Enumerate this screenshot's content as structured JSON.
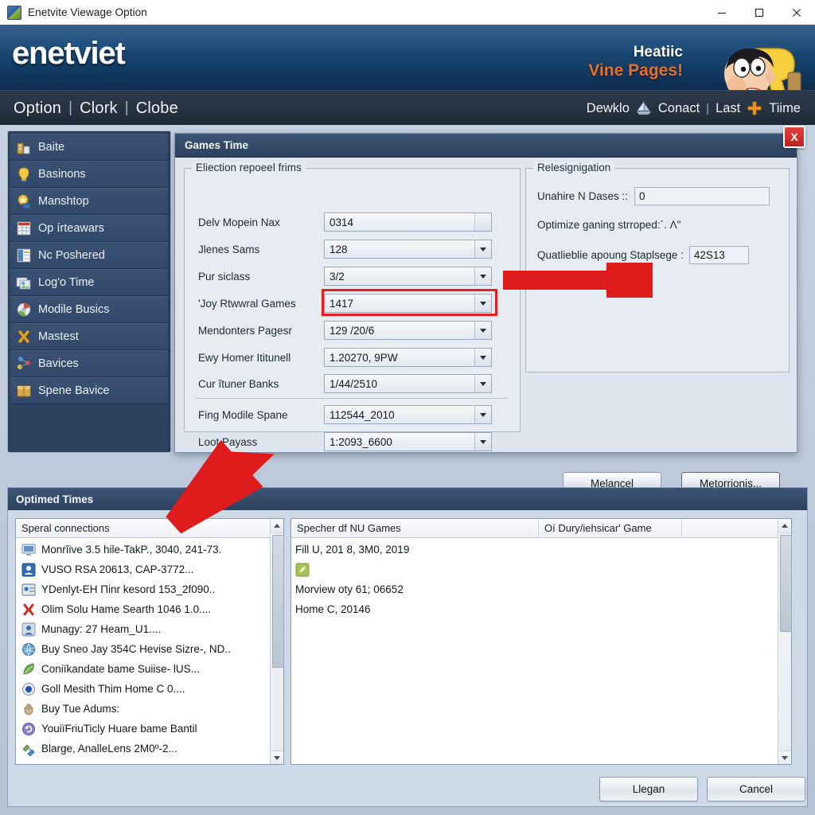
{
  "window": {
    "title": "Enetvite Viewage Option",
    "icon": "app-icon",
    "minimize": "minimize-icon",
    "maximize": "maximize-icon",
    "close": "close-icon"
  },
  "banner": {
    "brand": "enetviet",
    "tagline_line1": "Heatiic",
    "tagline_line2": "Vine Pages!",
    "mascot": "mascot-character",
    "colors": {
      "brand_bg_top": "#1d4f7e",
      "brand_bg_bottom": "#0d2c4d",
      "tagline_accent": "#e8702a"
    }
  },
  "nav": {
    "left": [
      "Option",
      "Clork",
      "Clobe"
    ],
    "separator": "|",
    "right": {
      "item1": "Dewklo",
      "boat_icon": "boat-icon",
      "item2": "Conact",
      "separator": "|",
      "item3": "Last",
      "plus_icon": "plus-icon",
      "item4": "Tiime"
    }
  },
  "sidebar": {
    "items": [
      {
        "label": "Baite",
        "icon": "buildings-icon"
      },
      {
        "label": "Basinons",
        "icon": "lightbulb-icon"
      },
      {
        "label": "Manshtop",
        "icon": "gold-badge-icon"
      },
      {
        "label": "Op írteawars",
        "icon": "spreadsheet-icon"
      },
      {
        "label": "Nc Poshered",
        "icon": "document-icon"
      },
      {
        "label": "Log'o Time",
        "icon": "photos-icon"
      },
      {
        "label": "Modile Busics",
        "icon": "disc-icon"
      },
      {
        "label": "Mastest",
        "icon": "x-cross-icon"
      },
      {
        "label": "Bavices",
        "icon": "network-icon"
      },
      {
        "label": "Spene Bavice",
        "icon": "package-icon"
      }
    ]
  },
  "dialog": {
    "title": "Games Time",
    "close_label": "X",
    "left_group": {
      "legend": "Eliection repoeel frims",
      "fields": [
        {
          "label": "Delv Mopein Nax",
          "value": "0314",
          "type": "text"
        },
        {
          "label": "Jlenes Sams",
          "value": "128",
          "type": "combo"
        },
        {
          "label": "Pur siclass",
          "value": "3/2",
          "type": "combo"
        },
        {
          "label": "'Joy Rtwwral Games",
          "value": "1417",
          "type": "combo",
          "highlighted": true
        },
        {
          "label": "Mendonters Pagesr",
          "value": "129 /20/6",
          "type": "combo"
        },
        {
          "label": "Ewy Homer Ititunell",
          "value": "1.20270, 9PW",
          "type": "combo"
        },
        {
          "label": "Cur îtuner Banks",
          "value": "1/44/2510",
          "type": "combo"
        }
      ],
      "fields2": [
        {
          "label": "Fing Modile Spane",
          "value": "112544_2010",
          "type": "combo"
        },
        {
          "label": "Loot Payass",
          "value": "1:2093_6600",
          "type": "combo"
        }
      ]
    },
    "right_group": {
      "legend": "Relesignigation",
      "field1_label": "Unahire N Dases ::",
      "field1_value": "0",
      "note": "Optimize ganing strroped:´. Λ\"",
      "field2_label": "Quatlieblie apoung Staplsege :",
      "field2_value": "42S13"
    },
    "buttons": [
      {
        "label": "Melancel"
      },
      {
        "label": "Metorrionis..."
      }
    ]
  },
  "lower_panel": {
    "title": "Optimed Times",
    "left_list": {
      "header": "Speral connections",
      "rows": [
        {
          "icon": "monitor-icon",
          "text": "Monrîive 3.5 hile-TakP., 3040, 241-73."
        },
        {
          "icon": "contact-icon",
          "text": "VUSO RSA 20613, CAP-3772..."
        },
        {
          "icon": "id-card-icon",
          "text": "YDenlyt-EH Пinr kesord 153_2f090.."
        },
        {
          "icon": "x-cross-icon",
          "text": "Olim Solu Hame Searth 1046 1.0...."
        },
        {
          "icon": "user-icon",
          "text": "Munagy: 27 Heam_U1...."
        },
        {
          "icon": "globe-icon",
          "text": "Buy Sneo Jay 354C Hevise Sizre-, ND.."
        },
        {
          "icon": "leaf-icon",
          "text": "Coniïkandate bame Suiise- lUS..."
        },
        {
          "icon": "circle-icon",
          "text": "Goll Mesith Thim Home C 0...."
        },
        {
          "icon": "bug-icon",
          "text": "Buy Tue Adums:"
        },
        {
          "icon": "refresh-icon",
          "text": "YouiïFriuTicly Huare bame Bantil"
        },
        {
          "icon": "plug-icon",
          "text": "Blarge, AnalleLens 2M0º-2..."
        }
      ]
    },
    "right_list": {
      "headers": [
        "Specher df NU Games",
        "Oí Dury/iehsicar' Game",
        ""
      ],
      "rows": [
        {
          "text": "Fill U, 201 8, 3M0, 2019",
          "badge": "glyph-icon"
        },
        {
          "text": "",
          "icon": "green-tile-icon"
        },
        {
          "text": "Morview oty 61; 06652"
        },
        {
          "text": "Home C, 20146"
        }
      ]
    },
    "buttons": [
      {
        "label": "Llegan"
      },
      {
        "label": "Cancel"
      }
    ]
  },
  "annotations": {
    "arrow_color": "#e01b1b",
    "arrow_right_target": "'Joy Rtwwral Games combo",
    "arrow_lower_target": "Speral connections first row"
  }
}
